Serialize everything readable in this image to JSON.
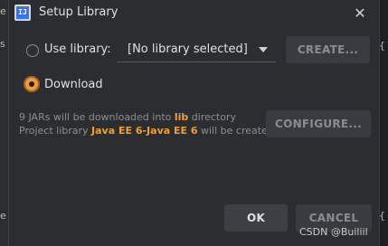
{
  "dialog": {
    "icon_text": "IJ",
    "title": "Setup Library",
    "close_glyph": "✕"
  },
  "options": {
    "use_library": {
      "label": "Use library:",
      "checked": false
    },
    "download": {
      "label": "Download",
      "checked": true
    }
  },
  "library_select": {
    "selected": "[No library selected]"
  },
  "buttons": {
    "create": "CREATE...",
    "configure": "CONFIGURE...",
    "ok": "OK",
    "cancel": "CANCEL"
  },
  "info": {
    "line1_prefix": "9 JARs will be downloaded into ",
    "line1_highlight": "lib",
    "line1_suffix": " directory",
    "line2_prefix": "Project library ",
    "line2_highlight": "Java EE 6-Java EE 6",
    "line2_suffix": " will be created"
  },
  "background_gutter": {
    "left": [
      "e",
      "s",
      "e"
    ],
    "right": [
      "{",
      "{"
    ]
  },
  "watermark": "CSDN @Builiil",
  "colors": {
    "accent": "#f29d36",
    "dialog_bg": "#2b2d30",
    "text": "#dfe1e5",
    "muted_text": "#8c8e92"
  }
}
